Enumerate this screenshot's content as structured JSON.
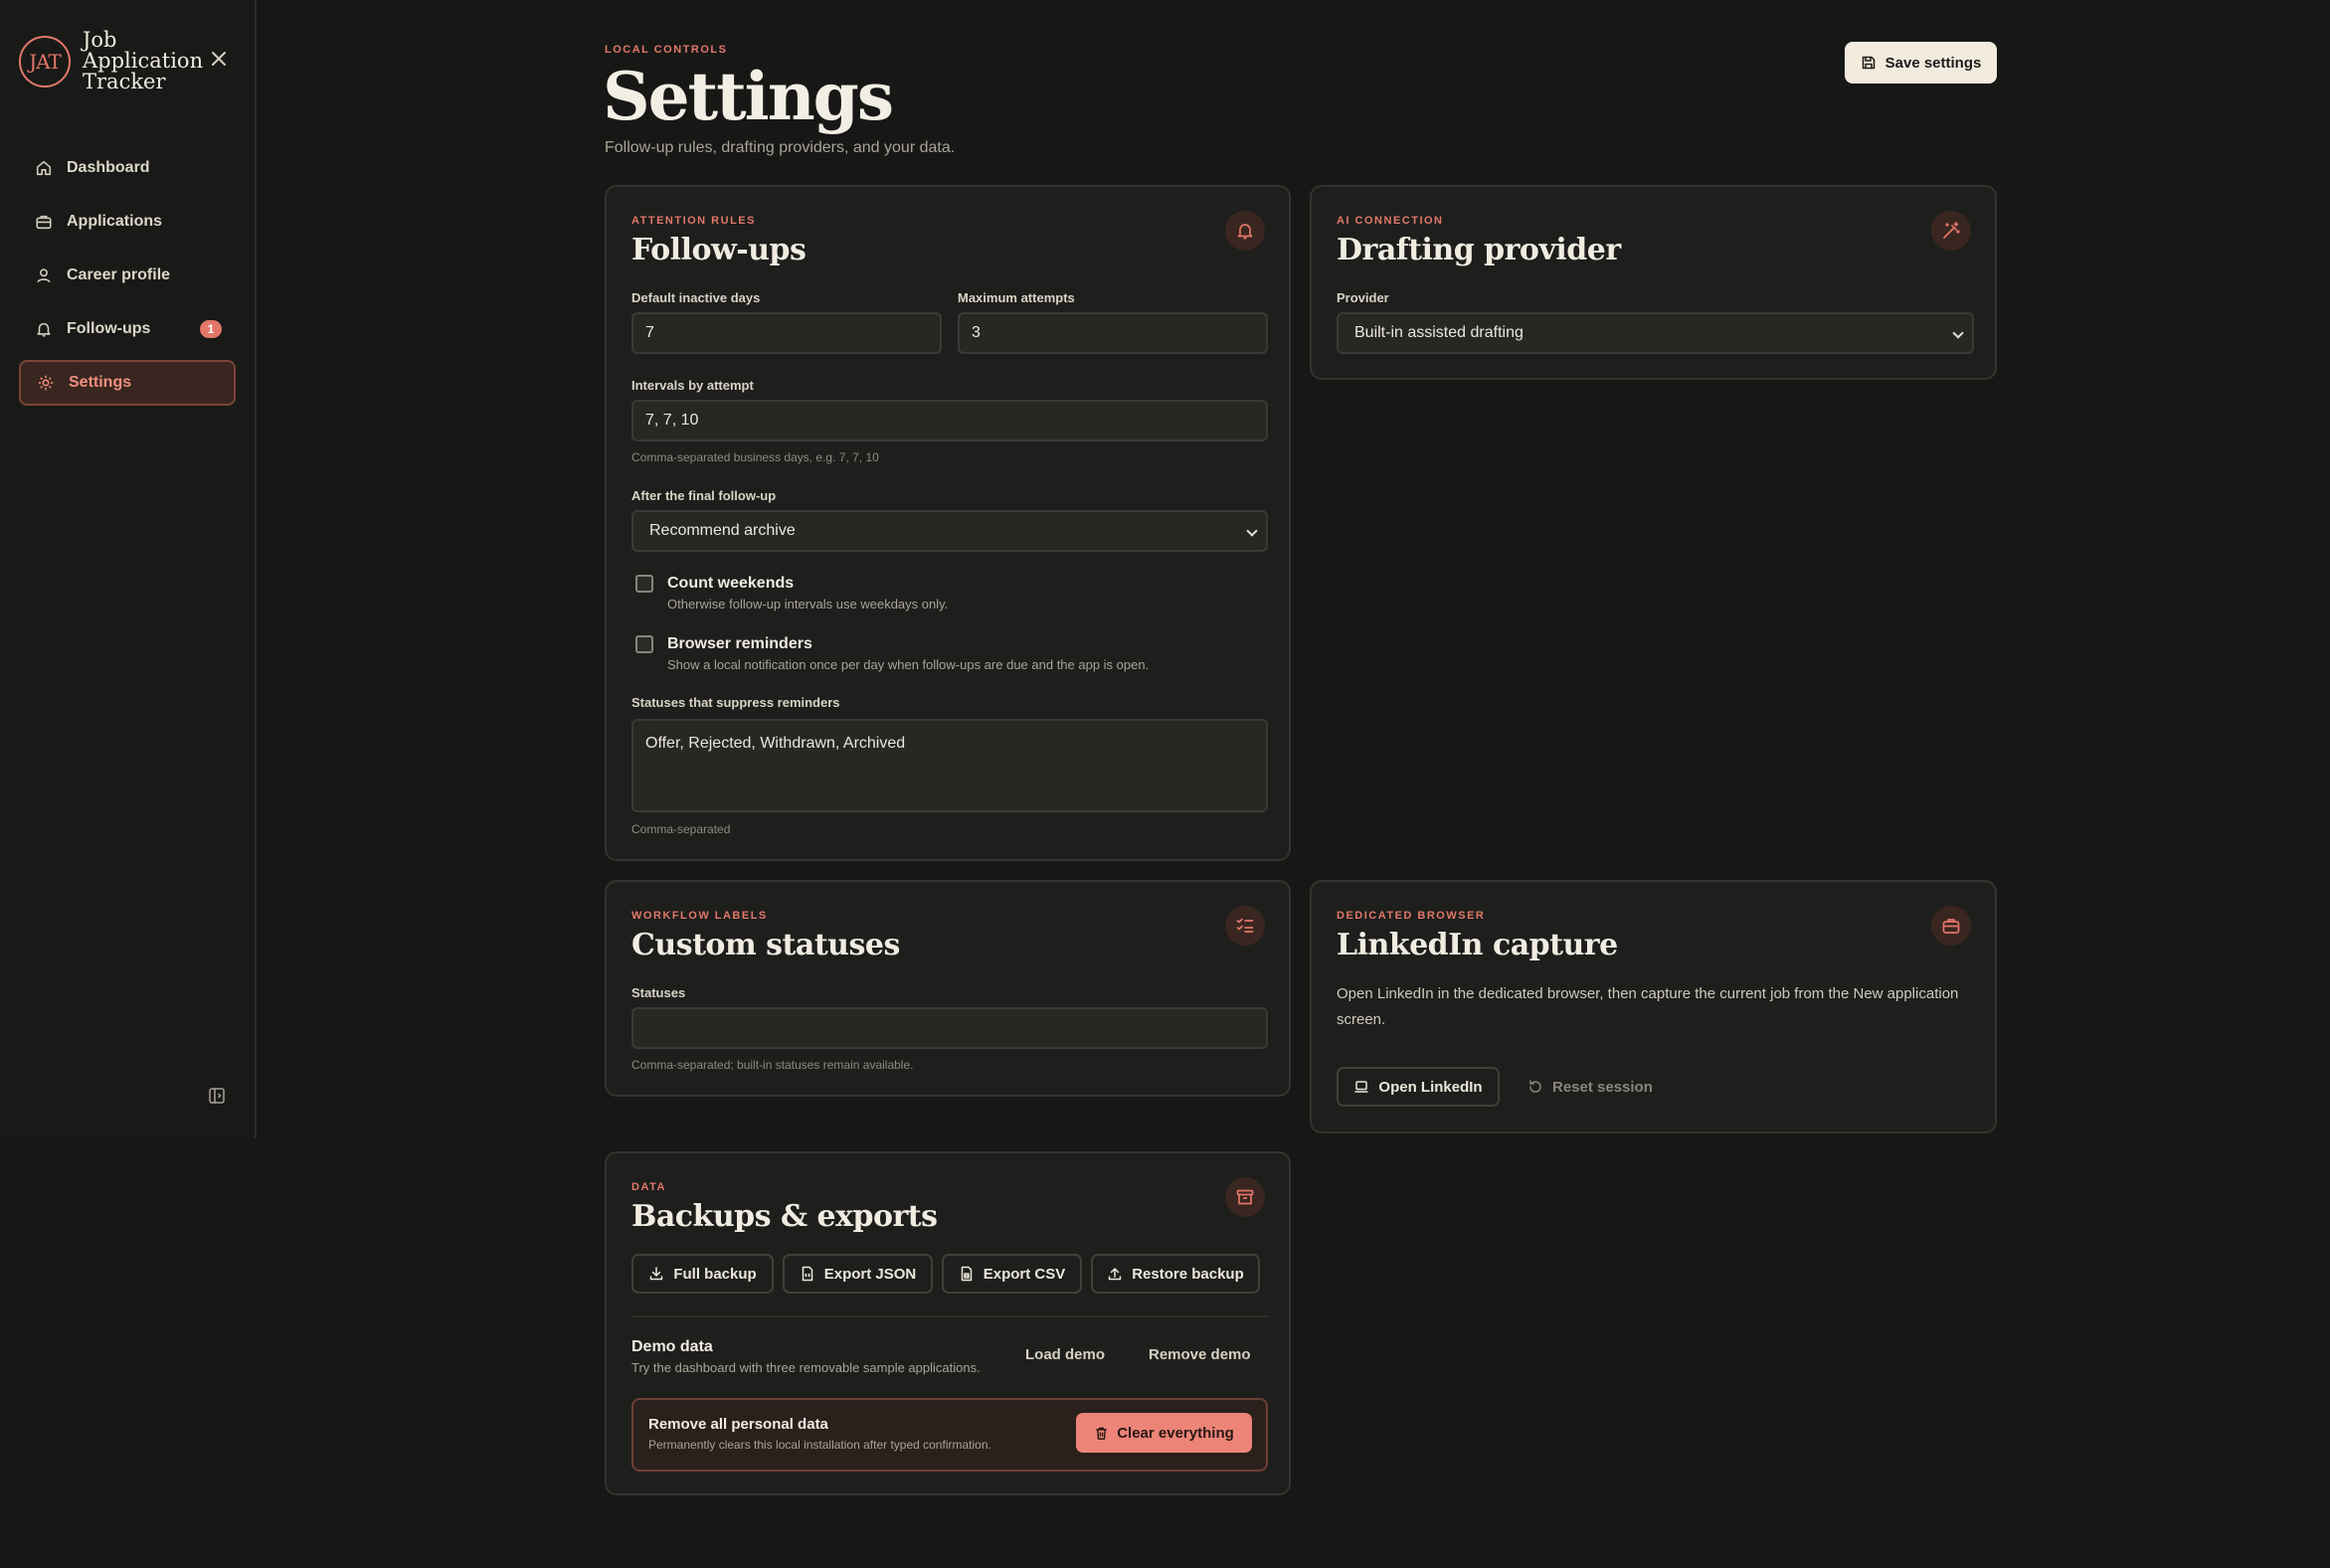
{
  "app": {
    "logo_text": "JAT",
    "name": "Job Application Tracker"
  },
  "nav": {
    "items": [
      {
        "label": "Dashboard",
        "icon": "home-icon"
      },
      {
        "label": "Applications",
        "icon": "briefcase-icon"
      },
      {
        "label": "Career profile",
        "icon": "user-icon"
      },
      {
        "label": "Follow-ups",
        "icon": "bell-icon",
        "badge": "1"
      },
      {
        "label": "Settings",
        "icon": "gear-icon",
        "active": true
      }
    ]
  },
  "header": {
    "eyebrow": "LOCAL CONTROLS",
    "title": "Settings",
    "subtitle": "Follow-up rules, drafting providers, and your data.",
    "save_label": "Save settings"
  },
  "followups": {
    "eyebrow": "ATTENTION RULES",
    "title": "Follow-ups",
    "default_inactive_label": "Default inactive days",
    "default_inactive_value": "7",
    "max_attempts_label": "Maximum attempts",
    "max_attempts_value": "3",
    "intervals_label": "Intervals by attempt",
    "intervals_value": "7, 7, 10",
    "intervals_hint": "Comma-separated business days, e.g. 7, 7, 10",
    "after_final_label": "After the final follow-up",
    "after_final_value": "Recommend archive",
    "count_weekends_title": "Count weekends",
    "count_weekends_desc": "Otherwise follow-up intervals use weekdays only.",
    "browser_reminders_title": "Browser reminders",
    "browser_reminders_desc": "Show a local notification once per day when follow-ups are due and the app is open.",
    "suppress_label": "Statuses that suppress reminders",
    "suppress_value": "Offer, Rejected, Withdrawn, Archived",
    "suppress_hint": "Comma-separated"
  },
  "drafting": {
    "eyebrow": "AI CONNECTION",
    "title": "Drafting provider",
    "provider_label": "Provider",
    "provider_value": "Built-in assisted drafting"
  },
  "custom_statuses": {
    "eyebrow": "WORKFLOW LABELS",
    "title": "Custom statuses",
    "statuses_label": "Statuses",
    "statuses_value": "",
    "hint": "Comma-separated; built-in statuses remain available."
  },
  "linkedin": {
    "eyebrow": "DEDICATED BROWSER",
    "title": "LinkedIn capture",
    "description": "Open LinkedIn in the dedicated browser, then capture the current job from the New application screen.",
    "open_label": "Open LinkedIn",
    "reset_label": "Reset session"
  },
  "backups": {
    "eyebrow": "DATA",
    "title": "Backups & exports",
    "full_backup": "Full backup",
    "export_json": "Export JSON",
    "export_csv": "Export CSV",
    "restore_backup": "Restore backup",
    "demo_title": "Demo data",
    "demo_desc": "Try the dashboard with three removable sample applications.",
    "load_demo": "Load demo",
    "remove_demo": "Remove demo",
    "remove_all_title": "Remove all personal data",
    "remove_all_desc": "Permanently clears this local installation after typed confirmation.",
    "clear_label": "Clear everything"
  }
}
